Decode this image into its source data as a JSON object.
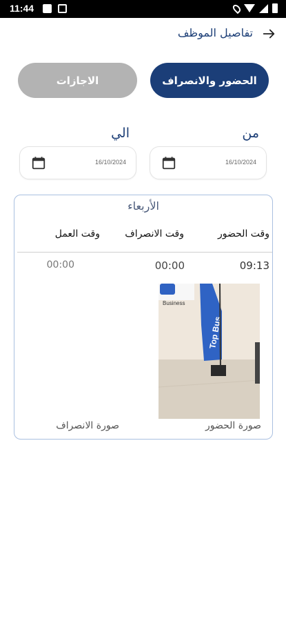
{
  "status_bar": {
    "time": "11:44"
  },
  "header": {
    "title": "تفاصيل الموظف"
  },
  "tabs": [
    {
      "label": "الحضور والانصراف",
      "active": true
    },
    {
      "label": "الاجازات",
      "active": false
    }
  ],
  "filters": {
    "from_label": "من",
    "to_label": "الي",
    "from_date": "16/10/2024",
    "to_date": "16/10/2024"
  },
  "record": {
    "day": "الأربعاء",
    "columns": {
      "check_in": "وقت الحضور",
      "check_out": "وقت الانصراف",
      "work_time": "وقت العمل"
    },
    "check_in": "09:13",
    "check_out": "00:00",
    "work_time": "00:00",
    "check_in_photo_label": "صورة الحضور",
    "check_out_photo_label": "صورة الانصراف",
    "photo_sign_text": "Top Bus",
    "photo_sign_text_2": "Business"
  },
  "colors": {
    "primary": "#1b3e78",
    "inactive_tab": "#b3b3b3",
    "card_border": "#a9bfe0"
  },
  "icons": [
    "back-arrow-icon",
    "calendar-icon",
    "location-icon",
    "wifi-icon",
    "signal-icon",
    "battery-icon"
  ]
}
